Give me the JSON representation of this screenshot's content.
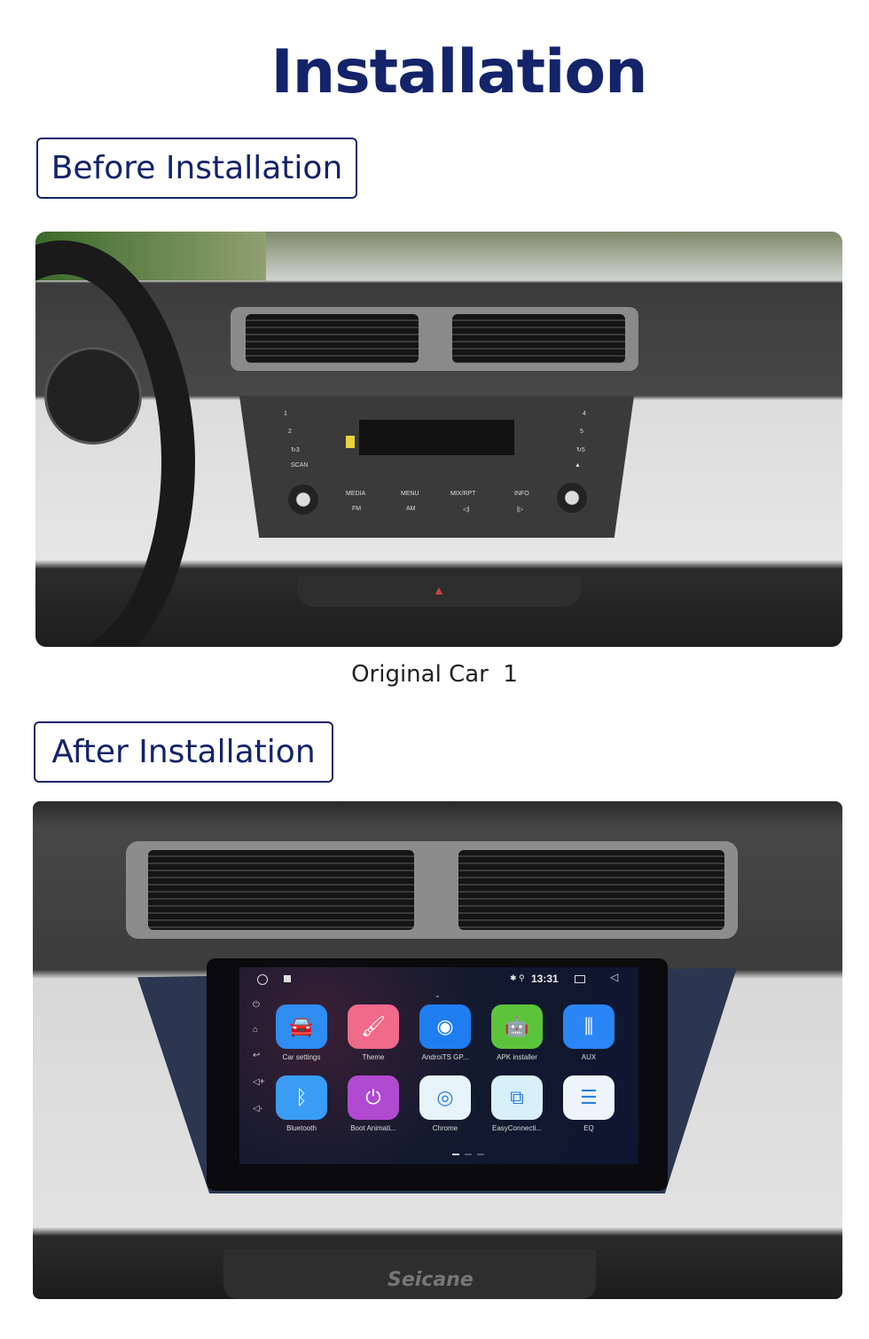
{
  "title": "Installation",
  "before": {
    "label": "Before Installation",
    "caption": "Original Car  1",
    "radio": {
      "preset_left": [
        "1",
        "2",
        "↻3",
        "SCAN"
      ],
      "preset_right": [
        "4",
        "5",
        "↻5",
        "▲"
      ],
      "buttons_top": [
        "MEDIA",
        "MENU",
        "MIX/RPT",
        "INFO"
      ],
      "buttons_bottom": [
        "FM",
        "AM",
        "◁|",
        "|▷"
      ]
    }
  },
  "after": {
    "label": "After Installation",
    "screen": {
      "time": "13:31",
      "status_icons": "✱ ⚲",
      "apps": [
        {
          "label": "Car settings",
          "icon": "car-settings-icon",
          "color": "#2f8cf0"
        },
        {
          "label": "Theme",
          "icon": "theme-brush-icon",
          "color": "#f06a8a"
        },
        {
          "label": "AndroiTS GP...",
          "icon": "gps-radar-icon",
          "color": "#1e7ef0"
        },
        {
          "label": "APK installer",
          "icon": "android-icon",
          "color": "#5cc43a"
        },
        {
          "label": "AUX",
          "icon": "aux-jack-icon",
          "color": "#2a85f5"
        },
        {
          "label": "Bluetooth",
          "icon": "bluetooth-icon",
          "color": "#3a9cf5"
        },
        {
          "label": "Boot Animati...",
          "icon": "power-icon",
          "color": "#b04ad0"
        },
        {
          "label": "Chrome",
          "icon": "chrome-icon",
          "color": "#e8f4fb"
        },
        {
          "label": "EasyConnecti...",
          "icon": "easyconnection-icon",
          "color": "#d8f0fa"
        },
        {
          "label": "EQ",
          "icon": "eq-icon",
          "color": "#eef4fb"
        }
      ]
    },
    "watermark": "Seicane"
  }
}
